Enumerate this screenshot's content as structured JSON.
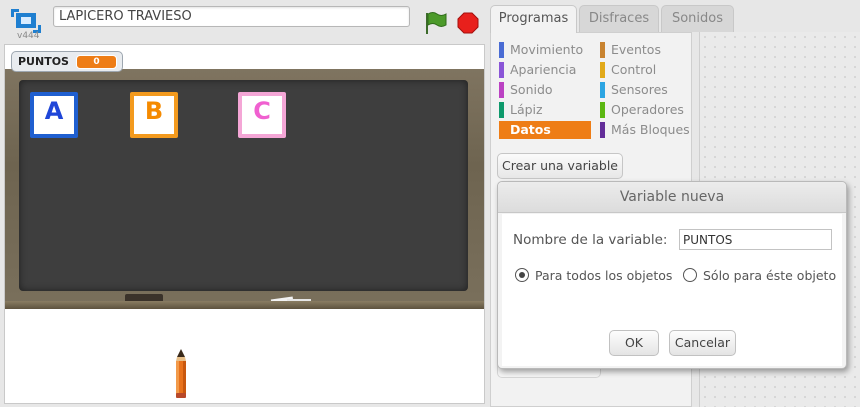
{
  "stage_header": {
    "project_title": "LAPICERO TRAVIESO",
    "version": "v444"
  },
  "stage": {
    "variable_monitor": {
      "name": "PUNTOS",
      "value": "0"
    },
    "tiles": [
      {
        "letter": "A",
        "color": "#1f5fd0"
      },
      {
        "letter": "B",
        "color": "#f39a1e"
      },
      {
        "letter": "C",
        "color": "#f4a6d6"
      }
    ]
  },
  "tabs": [
    "Programas",
    "Disfraces",
    "Sonidos"
  ],
  "palette": {
    "categories": [
      {
        "label": "Movimiento",
        "color": "#4a6cd4"
      },
      {
        "label": "Apariencia",
        "color": "#8a55d7"
      },
      {
        "label": "Sonido",
        "color": "#bb42c3"
      },
      {
        "label": "Lápiz",
        "color": "#0e9a6c"
      },
      {
        "label": "Datos",
        "color": "#ee7d16"
      },
      {
        "label": "Eventos",
        "color": "#c88330"
      },
      {
        "label": "Control",
        "color": "#e1a91a"
      },
      {
        "label": "Sensores",
        "color": "#2ca5e2"
      },
      {
        "label": "Operadores",
        "color": "#5cb712"
      },
      {
        "label": "Más Bloques",
        "color": "#632d99"
      }
    ],
    "active_category": "Datos",
    "create_variable_label": "Crear una variable"
  },
  "dialog": {
    "title": "Variable nueva",
    "name_label": "Nombre de la variable:",
    "name_value": "PUNTOS",
    "radio_all_label": "Para todos los objetos",
    "radio_this_label": "Sólo para éste objeto",
    "selected_radio": "Para todos los objetos",
    "ok_label": "OK",
    "cancel_label": "Cancelar"
  }
}
